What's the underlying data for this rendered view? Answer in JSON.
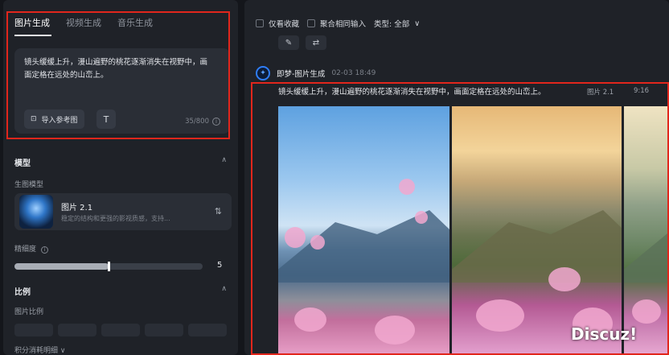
{
  "left_panel": {
    "tabs": [
      {
        "label": "图片生成",
        "active": true
      },
      {
        "label": "视频生成",
        "active": false
      },
      {
        "label": "音乐生成",
        "active": false
      }
    ],
    "prompt": {
      "text": "镜头缓缓上升，漫山遍野的桃花逐渐消失在视野中，画面定格在远处的山峦上。",
      "reference_button": "导入参考图",
      "char_count": "35/800"
    },
    "model_section": {
      "title": "模型",
      "sub_label": "生图模型",
      "model_name": "图片 2.1",
      "model_desc": "稳定的结构和更强的影视质感，支持..."
    },
    "precision": {
      "label": "精细度",
      "value": "5",
      "fraction": 0.5
    },
    "ratio_section": {
      "title": "比例",
      "sub_label": "图片比例"
    },
    "credits_label": "积分消耗明细"
  },
  "right_panel": {
    "filters": {
      "favorites_only": "仅看收藏",
      "aggregate_input": "聚合相同输入",
      "type_label": "类型: 全部"
    },
    "generation": {
      "title": "即梦-图片生成",
      "date": "02-03  18:49",
      "prompt": "镜头缓缓上升，漫山遍野的桃花逐渐消失在视野中，画面定格在远处的山峦上。",
      "model": "图片 2.1",
      "ratio": "9:16"
    }
  },
  "watermark": "Discuz!",
  "colors": {
    "highlight_red": "#e1261c",
    "accent_blue": "#2f7df6",
    "panel_bg": "#1f2228"
  }
}
